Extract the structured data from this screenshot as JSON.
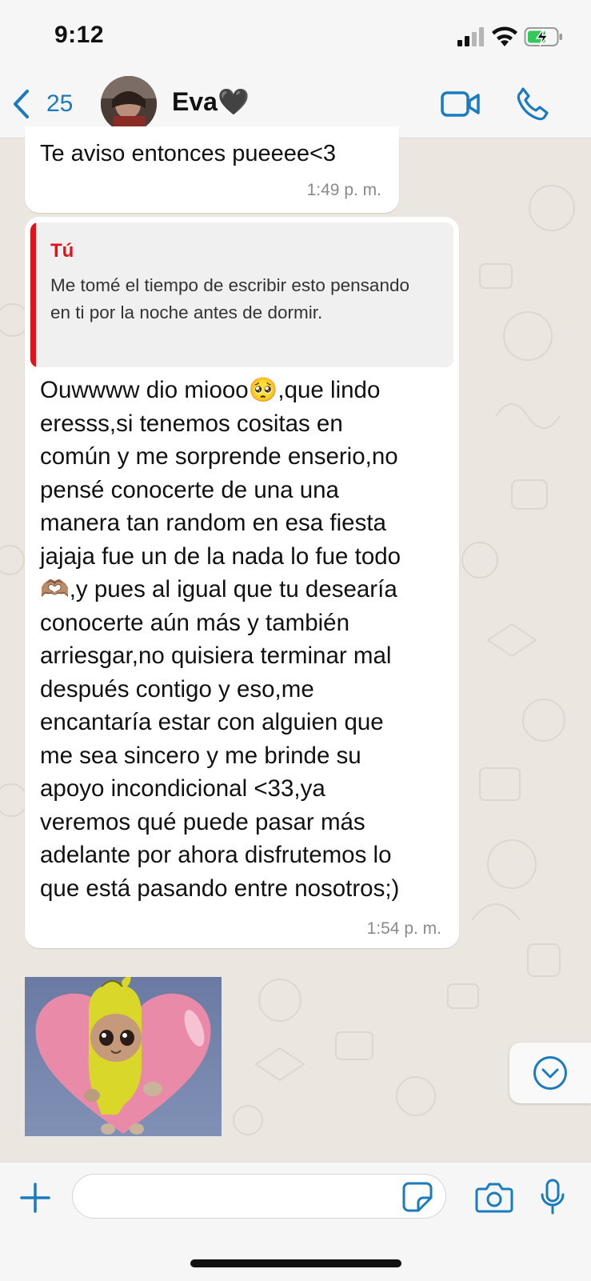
{
  "status_bar": {
    "time": "9:12",
    "icons": [
      "signal-icon",
      "wifi-icon",
      "battery-charging-icon"
    ]
  },
  "header": {
    "back_count": "25",
    "contact_name": "Eva🖤",
    "icons": [
      "chevron-left-icon",
      "video-camera-icon",
      "phone-icon"
    ]
  },
  "messages": [
    {
      "text": "Te aviso entonces pueeee<3",
      "time": "1:49 p. m."
    },
    {
      "quote": {
        "author": "Tú",
        "text": "Me tomé el tiempo de escribir esto pensando en ti por la noche antes de dormir."
      },
      "lines": [
        "Ouwwww dio miooo🥺,que lindo",
        "eresss,si tenemos cositas en",
        "común y me sorprende enserio,no",
        "pensé conocerte de una una",
        "manera tan random en esa fiesta",
        "jajaja fue un de la nada lo fue todo",
        "🫶🏽,y pues al igual que tu desearía",
        "conocerte aún más y también",
        "arriesgar,no quisiera terminar mal",
        "después contigo y eso,me",
        "encantaría estar con alguien que",
        "me sea sincero y me brinde su",
        "apoyo incondicional <33,ya",
        "veremos qué puede pasar más",
        "adelante por ahora disfrutemos lo",
        "que está pasando entre nosotros;)"
      ],
      "time": "1:54 p. m."
    }
  ],
  "sticker": {
    "icon": "banana-cat-heart-sticker"
  },
  "input_bar": {
    "placeholder": "",
    "icons": [
      "plus-icon",
      "sticker-icon",
      "camera-icon",
      "microphone-icon"
    ]
  },
  "scroll_button": {
    "icon": "chevron-down-circle-icon"
  },
  "colors": {
    "accent": "#1a7bbf",
    "quote_author": "#e2121a",
    "chat_background": "#ebe6df"
  }
}
